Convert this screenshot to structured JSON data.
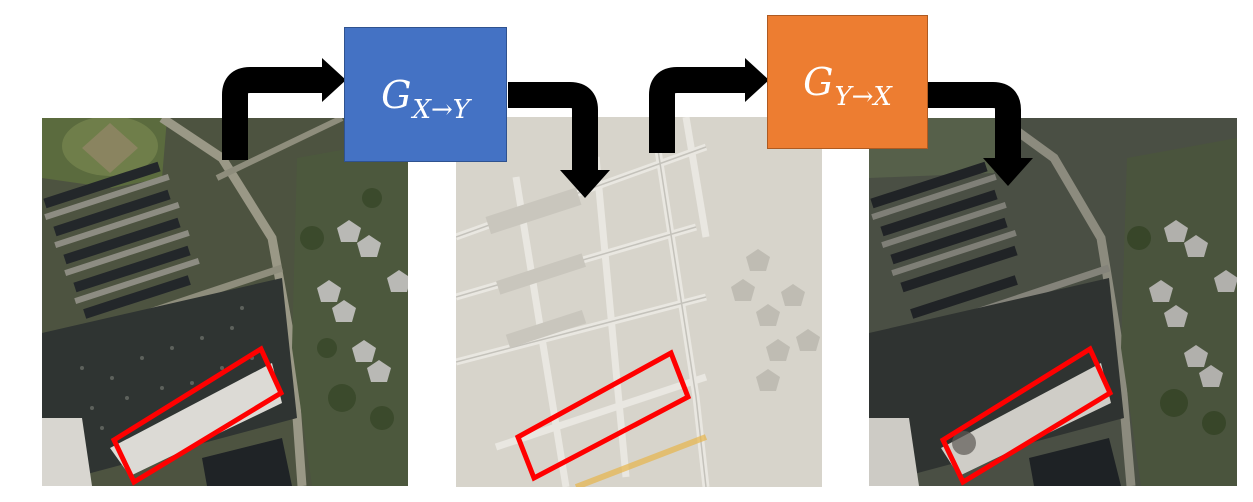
{
  "generator_forward": {
    "symbol": "G",
    "subscript": "X→Y",
    "box_color": "#4472c4"
  },
  "generator_backward": {
    "symbol": "G",
    "subscript": "Y→X",
    "box_color": "#ed7d31"
  },
  "highlight_color": "#ff0000",
  "arrow_color": "#000000"
}
